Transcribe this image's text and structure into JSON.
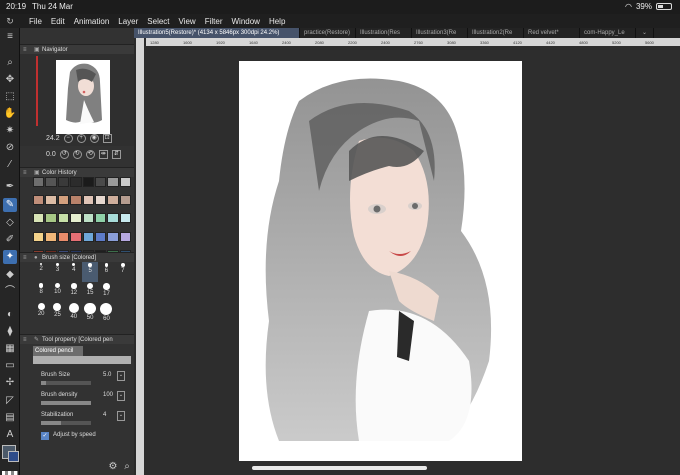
{
  "status": {
    "time": "20:19",
    "date": "Thu 24 Mar",
    "battery": "39%",
    "battery_level": 0.39
  },
  "menu": [
    "File",
    "Edit",
    "Animation",
    "Layer",
    "Select",
    "View",
    "Filter",
    "Window",
    "Help"
  ],
  "tabs": [
    "Illustration5(Restore)* (4134 x 5846px 300dpi 24.2%)",
    "practice(Restore)",
    "Illustration(Res",
    "Illustration3(Re",
    "Illustration2(Re",
    "Red velvet*",
    "com-Happy_Le"
  ],
  "navigator": {
    "title": "Navigator",
    "zoom": "24.2",
    "rotation": "0.0"
  },
  "color_history": {
    "title": "Color History",
    "colors": [
      "#6e6e6e",
      "#555555",
      "#3a3a3a",
      "#2c2c2c",
      "#1b1b1b",
      "#4a4a4a",
      "#9a9a9a",
      "#c9c9c9",
      "#c18f7a",
      "#dcbca5",
      "#d4a07e",
      "#b9826a",
      "#e0c4b7",
      "#e7d8cf",
      "#cfae9c",
      "#b59c8f",
      "#d8e4b6",
      "#a7c886",
      "#c7e0a8",
      "#e5efcf",
      "#bde0c6",
      "#8fd1a8",
      "#a8dcd9",
      "#c7e9ee",
      "#f4d38b",
      "#f1b779",
      "#e98c6b",
      "#e56f74",
      "#6ea8d9",
      "#5d7bc8",
      "#8a9ed8",
      "#b6a8e0",
      "#8a3b2d",
      "#6b2a1f",
      "#3b4a7a",
      "#273660",
      "#2b2b2b",
      "#1f1f1f",
      "#3c6e4a",
      "#2f4f6f"
    ]
  },
  "brush_size": {
    "title": "Brush size [Colored]",
    "sizes": [
      [
        "2",
        "3",
        "4",
        "5",
        "6",
        "7"
      ],
      [
        "8",
        "10",
        "12",
        "15",
        "17",
        ""
      ],
      [
        "20",
        "25",
        "40",
        "50",
        "60",
        ""
      ]
    ],
    "selected": "5"
  },
  "tool_property": {
    "title": "Tool property [Colored pen",
    "tool": "Colored pencil",
    "brush_size_label": "Brush Size",
    "brush_size_value": "5.0",
    "brush_size_fraction": 0.1,
    "density_label": "Brush density",
    "density_value": "100",
    "density_fraction": 1.0,
    "stabilization_label": "Stabilization",
    "stabilization_value": "4",
    "stabilization_fraction": 0.4,
    "adjust_label": "Adjust by speed"
  },
  "ruler_ticks": [
    "1280",
    "1600",
    "1920",
    "1640",
    "2400",
    "2080",
    "2200",
    "2400",
    "2760",
    "3080",
    "3360",
    "4120",
    "4420",
    "4800",
    "5200",
    "5600"
  ]
}
